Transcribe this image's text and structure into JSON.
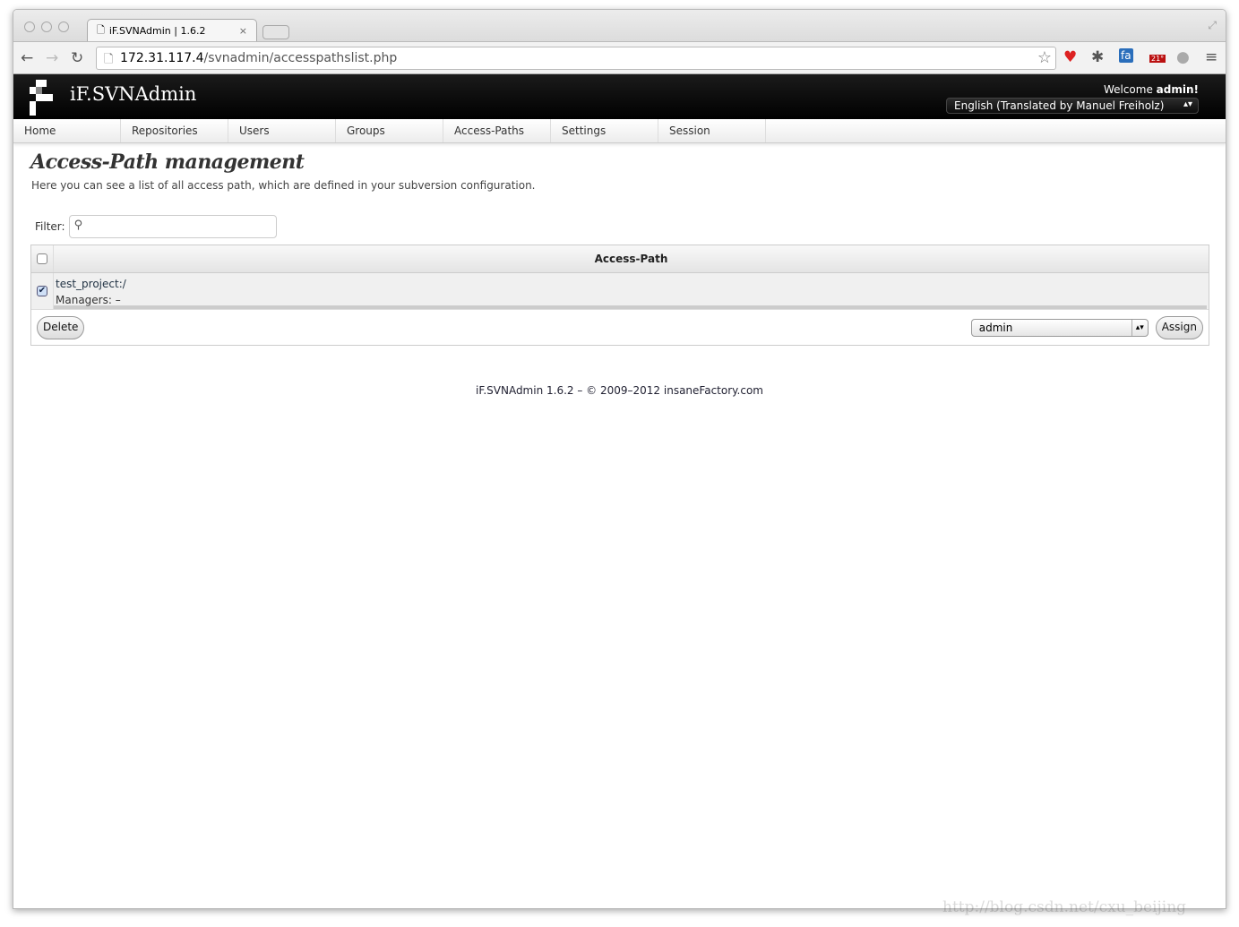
{
  "browser": {
    "tab_title": "iF.SVNAdmin | 1.6.2",
    "url_host": "172.31.117.4",
    "url_path": "/svnadmin/accesspathslist.php",
    "weather_badge": "21°"
  },
  "header": {
    "brand": "iF.SVNAdmin",
    "welcome_prefix": "Welcome ",
    "welcome_user": "admin!",
    "language": "English (Translated by Manuel Freiholz)"
  },
  "nav": [
    "Home",
    "Repositories",
    "Users",
    "Groups",
    "Access-Paths",
    "Settings",
    "Session"
  ],
  "page": {
    "title": "Access-Path management",
    "description": "Here you can see a list of all access path, which are defined in your subversion configuration.",
    "filter_label": "Filter:",
    "filter_value": ""
  },
  "table": {
    "header": "Access-Path",
    "rows": [
      {
        "path": "test_project:/",
        "managers": "Managers: –",
        "checked": true
      }
    ]
  },
  "actions": {
    "delete": "Delete",
    "assign": "Assign",
    "user_select": "admin"
  },
  "footer": {
    "text": "iF.SVNAdmin 1.6.2 – © 2009–2012 ",
    "link": "insaneFactory.com"
  },
  "watermark": "http://blog.csdn.net/cxu_beijing"
}
